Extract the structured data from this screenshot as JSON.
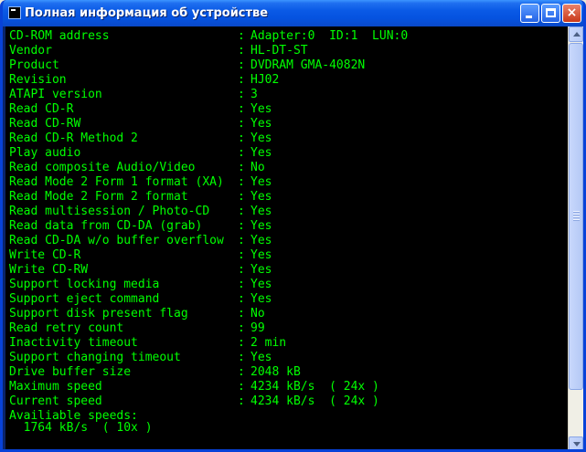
{
  "window": {
    "title": "Полная информация об устройстве"
  },
  "titlebar_buttons": {
    "minimize": "minimize",
    "maximize": "maximize",
    "close": "×"
  },
  "lines": [
    {
      "key": "CD-ROM address",
      "value": "Adapter:0  ID:1  LUN:0"
    },
    {
      "key": "Vendor",
      "value": "HL-DT-ST"
    },
    {
      "key": "Product",
      "value": "DVDRAM GMA-4082N"
    },
    {
      "key": "Revision",
      "value": "HJ02"
    },
    {
      "key": "ATAPI version",
      "value": "3"
    },
    {
      "key": "Read CD-R",
      "value": "Yes"
    },
    {
      "key": "Read CD-RW",
      "value": "Yes"
    },
    {
      "key": "Read CD-R Method 2",
      "value": "Yes"
    },
    {
      "key": "Play audio",
      "value": "Yes"
    },
    {
      "key": "Read composite Audio/Video",
      "value": "No"
    },
    {
      "key": "Read Mode 2 Form 1 format (XA)",
      "value": "Yes"
    },
    {
      "key": "Read Mode 2 Form 2 format",
      "value": "Yes"
    },
    {
      "key": "Read multisession / Photo-CD",
      "value": "Yes"
    },
    {
      "key": "Read data from CD-DA (grab)",
      "value": "Yes"
    },
    {
      "key": "Read CD-DA w/o buffer overflow",
      "value": "Yes"
    },
    {
      "key": "Write CD-R",
      "value": "Yes"
    },
    {
      "key": "Write CD-RW",
      "value": "Yes"
    },
    {
      "key": "Support locking media",
      "value": "Yes"
    },
    {
      "key": "Support eject command",
      "value": "Yes"
    },
    {
      "key": "Support disk present flag",
      "value": "No"
    },
    {
      "key": "Read retry count",
      "value": "99"
    },
    {
      "key": "Inactivity timeout",
      "value": "2 min"
    },
    {
      "key": "Support changing timeout",
      "value": "Yes"
    },
    {
      "key": "Drive buffer size",
      "value": "2048 kB"
    },
    {
      "key": "Maximum speed",
      "value": "4234 kB/s  ( 24x )"
    },
    {
      "key": "Current speed",
      "value": "4234 kB/s  ( 24x )"
    }
  ],
  "available_speeds_label": "Availiable speeds:",
  "speed_partial_line": "  1764 kB/s  ( 10x )",
  "separator": ":",
  "scroll": {
    "position_fraction": 0.0,
    "visible_fraction": 0.85
  }
}
